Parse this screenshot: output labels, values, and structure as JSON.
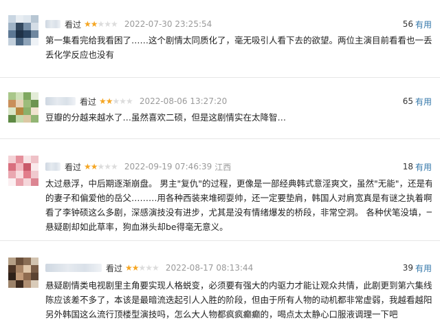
{
  "comments": [
    {
      "watched": "看过",
      "rating": 2,
      "stars_full": "★★",
      "stars_empty": "★★★",
      "time": "2022-07-30 23:25:54",
      "location": "",
      "count": "56",
      "useful": "有用",
      "lines": [
        "第一集看完给我看困了……这个剧情太同质化了，毫无吸引人看下去的欲望。两位主演目前看看也一丢丢丢",
        "丢化学反应也没有"
      ]
    },
    {
      "watched": "看过",
      "rating": 2,
      "stars_full": "★★",
      "stars_empty": "★★★",
      "time": "2022-08-06 13:27:20",
      "location": "",
      "count": "65",
      "useful": "有用",
      "lines": [
        "豆瓣的分越来越水了…虽然喜欢二硕，但是这剧情实在太降智…"
      ]
    },
    {
      "watched": "看过",
      "rating": 2,
      "stars_full": "★★",
      "stars_empty": "★★★",
      "time": "2022-09-19 07:46:39",
      "location": "江西",
      "count": "18",
      "useful": "有用",
      "lines": [
        "太过悬浮，中后期逐渐崩盘。 男主\"复仇\"的过程，更像是一部经典韩式意淫爽文，虽然\"无能\"，还是有美丽",
        "的妻子和偏爱他的岳父………用各种西装来堆砌耍帅，还一定要垫肩，韩国人对肩宽真是有谜之执着啊。",
        "看了李钟硕这么多剧，深感演技没有进步，尤其是没有情绪爆发的桥段，非常空洞。 各种伏笔没填，一部",
        "悬疑剧却如此草率，狗血淋头却be得毫无意义。"
      ]
    },
    {
      "watched": "看过",
      "rating": 2,
      "stars_full": "★★",
      "stars_empty": "★★★",
      "time": "2022-08-17 08:13:44",
      "location": "",
      "count": "39",
      "useful": "有用",
      "lines": [
        "悬疑剧情类电视剧里主角要实现人格蜕变，必须要有强大的内驱力才能让观众共情，此剧更到第六集线索铺",
        "陈应该差不多了，本该是最暗流迭起引人入胜的阶段，但由于所有人物的动机都非常虚弱，我越看越阳痿。",
        "另外韩国这么流行顶楼型演技吗，怎么大人物都疯疯癫癫的，喝点太太静心口服液调理一下吧"
      ]
    }
  ]
}
